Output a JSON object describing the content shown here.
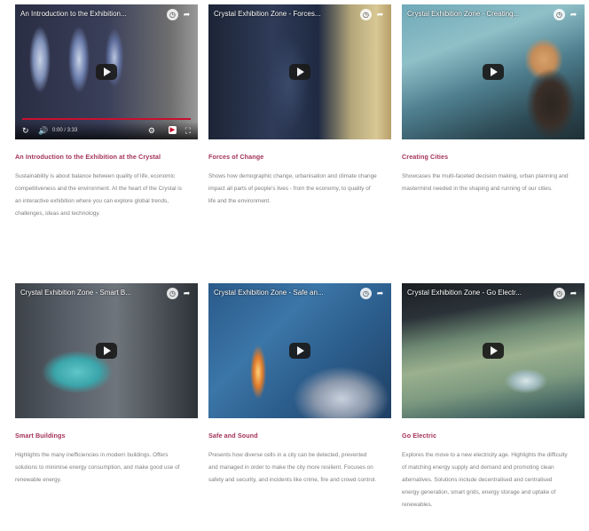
{
  "videos": [
    {
      "video_title": "An Introduction to the Exhibition...",
      "title": "An Introduction to the Exhibition at the Crystal",
      "description": "Sustainability is about balance between quality of life, economic competitiveness and the environment. At the heart of the Crystal is an interactive exhibition where you can explore global trends, challenges, ideas and technology.",
      "time": "0:00 / 3:33"
    },
    {
      "video_title": "Crystal Exhibition Zone - Forces...",
      "title": "Forces of Change",
      "description": "Shows how demographic change, urbanisation and climate change impact all parts of people's lives - from the economy, to quality of life and the environment."
    },
    {
      "video_title": "Crystal Exhibition Zone - Creating...",
      "title": "Creating Cities",
      "description": "Showcases the multi-faceted decision making, urban planning and mastermind needed in the shaping and running of our cities."
    },
    {
      "video_title": "Crystal Exhibition Zone - Smart B...",
      "title": "Smart Buildings",
      "description": "Highlights the many inefficiencies in modern buildings. Offers solutions to minimise energy consumption, and make good use of renewable energy."
    },
    {
      "video_title": "Crystal Exhibition Zone - Safe an...",
      "title": "Safe and Sound",
      "description": "Presents how diverse cells in a city can be detected, prevented and managed in order to make the city more resilient. Focuses on safety and security, and incidents like crime, fire and crowd control."
    },
    {
      "video_title": "Crystal Exhibition Zone - Go Electr...",
      "title": "Go Electric",
      "description": "Explores the move to a new electricity age. Highlights the difficulty of matching energy supply and demand and promoting clean alternatives. Solutions include decentralised and centralised energy generation, smart grids, energy storage and uptake of renewables."
    }
  ],
  "colors": {
    "accent": "#a3325a",
    "description_text": "#7f7f7f",
    "progress_bar": "#c8102e"
  },
  "icons": [
    "watch-later-icon",
    "share-icon",
    "play-icon",
    "replay-icon",
    "volume-icon",
    "settings-icon",
    "youtube-icon",
    "fullscreen-icon"
  ]
}
